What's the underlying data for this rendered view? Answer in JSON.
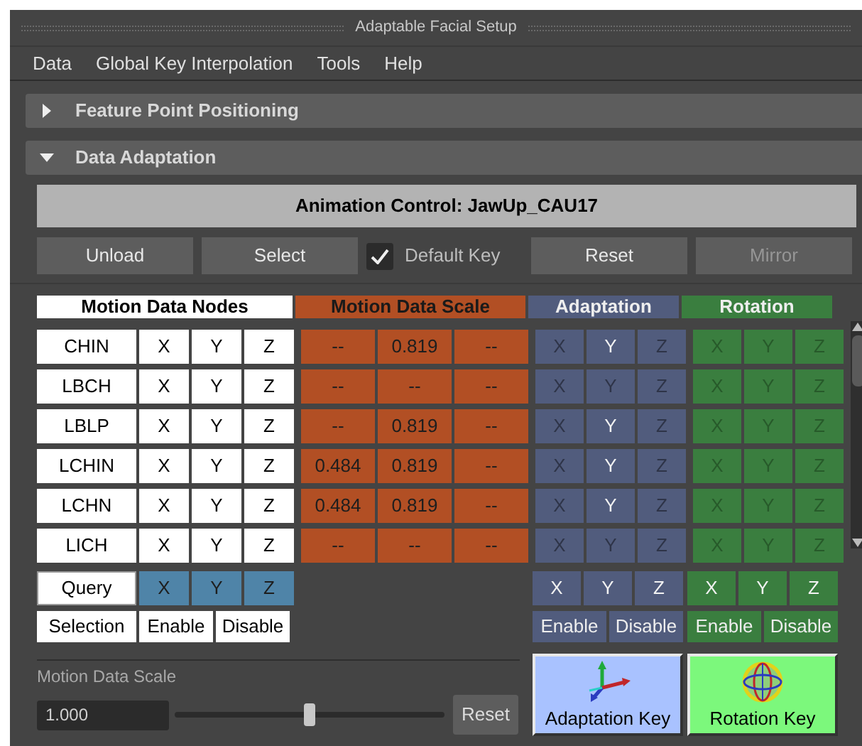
{
  "window": {
    "title": "Adaptable Facial Setup"
  },
  "menu": [
    "Data",
    "Global Key Interpolation",
    "Tools",
    "Help"
  ],
  "sections": [
    {
      "title": "Feature Point Positioning",
      "expanded": false
    },
    {
      "title": "Data Adaptation",
      "expanded": true
    }
  ],
  "animation_control": "Animation Control: JawUp_CAU17",
  "toolbar": [
    {
      "kind": "button",
      "label": "Unload",
      "disabled": false
    },
    {
      "kind": "button",
      "label": "Select",
      "disabled": false
    },
    {
      "kind": "checkbox",
      "label": "Default Key",
      "checked": true
    },
    {
      "kind": "button",
      "label": "Reset",
      "disabled": false
    },
    {
      "kind": "button",
      "label": "Mirror",
      "disabled": true
    }
  ],
  "headers": [
    "Motion Data Nodes",
    "Motion Data Scale",
    "Adaptation",
    "Rotation"
  ],
  "rows": [
    {
      "node": "CHIN",
      "axes": [
        "X",
        "Y",
        "Z"
      ],
      "scale": [
        "--",
        "0.819",
        "--"
      ],
      "adaptation": [
        {
          "label": "X",
          "on": false
        },
        {
          "label": "Y",
          "on": true
        },
        {
          "label": "Z",
          "on": false
        }
      ],
      "rotation": [
        {
          "label": "X",
          "on": false
        },
        {
          "label": "Y",
          "on": false
        },
        {
          "label": "Z",
          "on": false
        }
      ]
    },
    {
      "node": "LBCH",
      "axes": [
        "X",
        "Y",
        "Z"
      ],
      "scale": [
        "--",
        "--",
        "--"
      ],
      "adaptation": [
        {
          "label": "X",
          "on": false
        },
        {
          "label": "Y",
          "on": false
        },
        {
          "label": "Z",
          "on": false
        }
      ],
      "rotation": [
        {
          "label": "X",
          "on": false
        },
        {
          "label": "Y",
          "on": false
        },
        {
          "label": "Z",
          "on": false
        }
      ]
    },
    {
      "node": "LBLP",
      "axes": [
        "X",
        "Y",
        "Z"
      ],
      "scale": [
        "--",
        "0.819",
        "--"
      ],
      "adaptation": [
        {
          "label": "X",
          "on": false
        },
        {
          "label": "Y",
          "on": true
        },
        {
          "label": "Z",
          "on": false
        }
      ],
      "rotation": [
        {
          "label": "X",
          "on": false
        },
        {
          "label": "Y",
          "on": false
        },
        {
          "label": "Z",
          "on": false
        }
      ]
    },
    {
      "node": "LCHIN",
      "axes": [
        "X",
        "Y",
        "Z"
      ],
      "scale": [
        "0.484",
        "0.819",
        "--"
      ],
      "adaptation": [
        {
          "label": "X",
          "on": false
        },
        {
          "label": "Y",
          "on": true
        },
        {
          "label": "Z",
          "on": false
        }
      ],
      "rotation": [
        {
          "label": "X",
          "on": false
        },
        {
          "label": "Y",
          "on": false
        },
        {
          "label": "Z",
          "on": false
        }
      ]
    },
    {
      "node": "LCHN",
      "axes": [
        "X",
        "Y",
        "Z"
      ],
      "scale": [
        "0.484",
        "0.819",
        "--"
      ],
      "adaptation": [
        {
          "label": "X",
          "on": false
        },
        {
          "label": "Y",
          "on": true
        },
        {
          "label": "Z",
          "on": false
        }
      ],
      "rotation": [
        {
          "label": "X",
          "on": false
        },
        {
          "label": "Y",
          "on": false
        },
        {
          "label": "Z",
          "on": false
        }
      ]
    },
    {
      "node": "LICH",
      "axes": [
        "X",
        "Y",
        "Z"
      ],
      "scale": [
        "--",
        "--",
        "--"
      ],
      "adaptation": [
        {
          "label": "X",
          "on": false
        },
        {
          "label": "Y",
          "on": false
        },
        {
          "label": "Z",
          "on": false
        }
      ],
      "rotation": [
        {
          "label": "X",
          "on": false
        },
        {
          "label": "Y",
          "on": false
        },
        {
          "label": "Z",
          "on": false
        }
      ]
    }
  ],
  "query": {
    "label": "Query",
    "axes": [
      "X",
      "Y",
      "Z"
    ],
    "selection": "Selection",
    "enable": "Enable",
    "disable": "Disable"
  },
  "adaptation_controls": {
    "axes": [
      "X",
      "Y",
      "Z"
    ],
    "enable": "Enable",
    "disable": "Disable"
  },
  "rotation_controls": {
    "axes": [
      "X",
      "Y",
      "Z"
    ],
    "enable": "Enable",
    "disable": "Disable"
  },
  "motion_data_scale": {
    "label": "Motion Data Scale",
    "value": "1.000",
    "level": 0.5,
    "reset": "Reset"
  },
  "keys": [
    {
      "kind": "adaptation",
      "label": "Adaptation Key"
    },
    {
      "kind": "rotation",
      "label": "Rotation Key"
    }
  ]
}
